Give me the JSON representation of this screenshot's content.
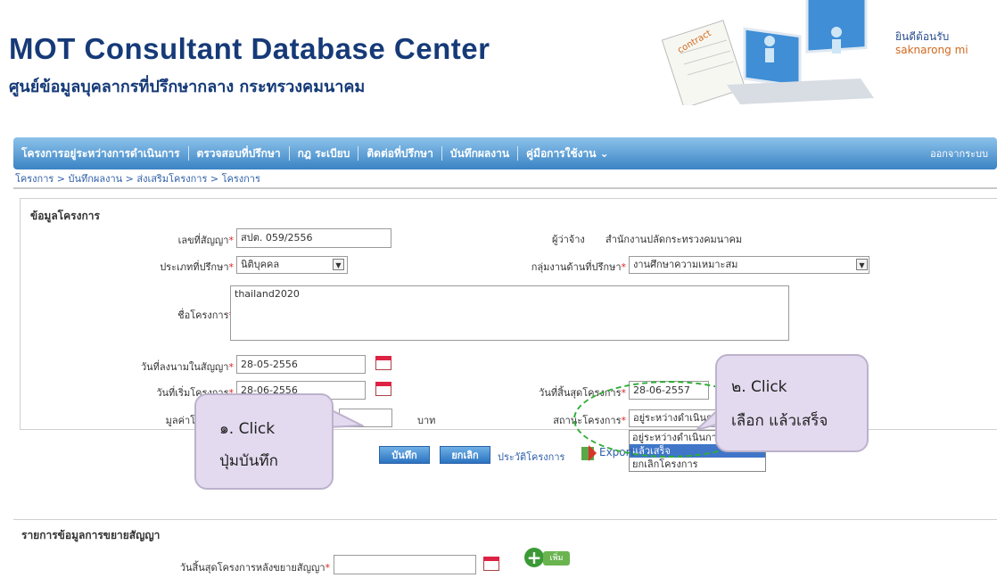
{
  "header": {
    "title": "MOT Consultant Database Center",
    "subtitle": "ศูนย์ข้อมูลบุคลากรที่ปรึกษากลาง กระทรวงคมนาคม",
    "welcome": "ยินดีต้อนรับ",
    "username": "saknarong mi"
  },
  "nav": {
    "items": [
      "โครงการอยู่ระหว่างการดำเนินการ",
      "ตรวจสอบที่ปรึกษา",
      "กฎ ระเบียบ",
      "ติดต่อที่ปรึกษา",
      "บันทึกผลงาน",
      "คู่มือการใช้งาน"
    ],
    "end": "ออกจากระบบ"
  },
  "breadcrumb": "โครงการ > บันทึกผลงาน > ส่งเสริมโครงการ > โครงการ",
  "form": {
    "section_title": "ข้อมูลโครงการ",
    "contract_no": {
      "label": "เลขที่สัญญา",
      "value": "สปต. 059/2556"
    },
    "employer": {
      "label": "ผู้ว่าจ้าง",
      "value": "สำนักงานปลัดกระทรวงคมนาคม"
    },
    "consult_type": {
      "label": "ประเภทที่ปรึกษา",
      "value": "นิติบุคคล"
    },
    "work_group": {
      "label": "กลุ่มงานด้านที่ปรึกษา",
      "value": "งานศึกษาความเหมาะสม"
    },
    "project_name": {
      "label": "ชื่อโครงการ",
      "value": "thailand2020"
    },
    "sign_date": {
      "label": "วันที่ลงนามในสัญญา",
      "value": "28-05-2556"
    },
    "start_date": {
      "label": "วันที่เริ่มโครงการ",
      "value": "28-06-2556"
    },
    "end_date": {
      "label": "วันที่สิ้นสุดโครงการ",
      "value": "28-06-2557"
    },
    "project_value": {
      "label": "มูลค่าโครงการ",
      "value": "",
      "unit": "บาท"
    },
    "status": {
      "label": "สถานะโครงการ",
      "value": "อยู่ระหว่างดำเนินการ",
      "options": [
        "อยู่ระหว่างดำเนินการ",
        "แล้วเสร็จ",
        "ยกเลิกโครงการ"
      ]
    },
    "save_button": "บันทึก",
    "cancel_button": "ยกเลิก",
    "back_link": "ประวัติโครงการ",
    "export_link": "Export"
  },
  "callouts": {
    "one_line1": "๑.  Click",
    "one_line2": "ปุ่มบันทึก",
    "two_line1": "๒.  Click",
    "two_line2": "เลือก แล้วเสร็จ"
  },
  "lower": {
    "section_title": "รายการข้อมูลการขยายสัญญา",
    "end_date_label": "วันสิ้นสุดโครงการหลังขยายสัญญา",
    "end_date_value": "",
    "add_label": "เพิ่ม"
  },
  "colors": {
    "brand": "#163a78",
    "nav": "#3a83c4",
    "accent": "#2fae34",
    "callout": "#e3daef"
  }
}
